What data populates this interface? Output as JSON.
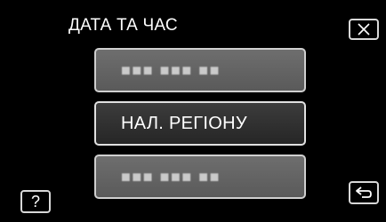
{
  "header": {
    "title": "ДАТА ТА ЧАС"
  },
  "menu": {
    "items": [
      {
        "label": "■■■ ■■■ ■■",
        "state": "placeholder"
      },
      {
        "label": "НАЛ. РЕГІОНУ",
        "state": "selected"
      },
      {
        "label": "■■■ ■■■ ■■",
        "state": "placeholder"
      }
    ]
  },
  "controls": {
    "close_icon": "close-icon",
    "back_icon": "return-arrow-icon",
    "help_label": "?"
  },
  "colors": {
    "background": "#000000",
    "button_fill": "#6e6e6e",
    "button_selected_fill": "#2e2e2e",
    "button_border": "#cfcfcf",
    "text": "#ffffff"
  }
}
